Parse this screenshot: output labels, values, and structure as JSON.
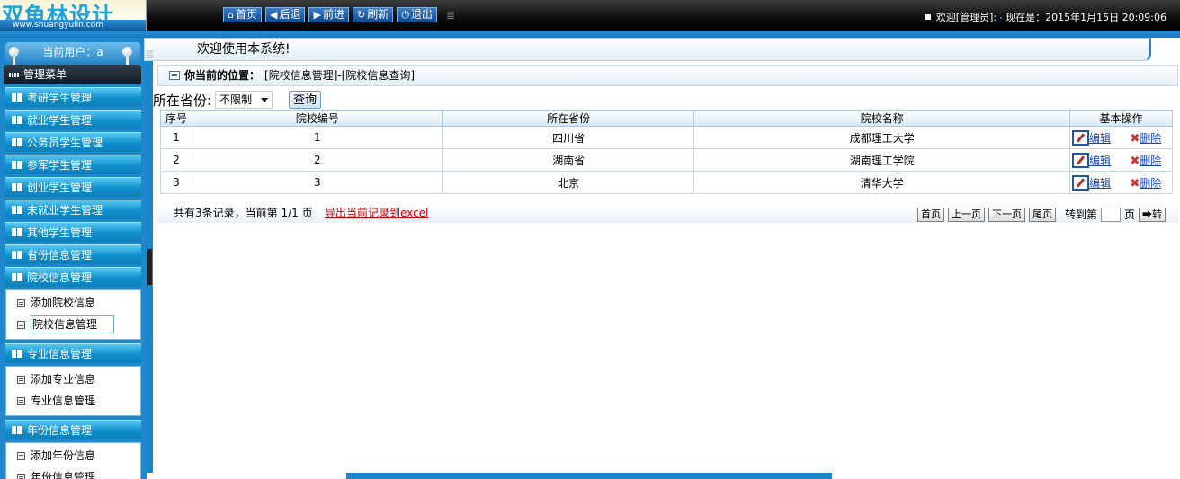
{
  "logo": {
    "main": "双鱼林设计",
    "sub": "www.shuangyulin.com"
  },
  "nav": [
    {
      "icon": "home-icon",
      "glyph": "⌂",
      "label": "首页"
    },
    {
      "icon": "back-icon",
      "glyph": "◀",
      "label": "后退"
    },
    {
      "icon": "forward-icon",
      "glyph": "▶",
      "label": "前进"
    },
    {
      "icon": "refresh-icon",
      "glyph": "↻",
      "label": "刷新"
    },
    {
      "icon": "power-icon",
      "glyph": "⏻",
      "label": "退出"
    }
  ],
  "header": {
    "welcome": "欢迎[管理员]:",
    "time": "现在是：2015年1月15日 20:09:06"
  },
  "sidebar": {
    "current_user": "当前用户：a",
    "menu_title": "管理菜单",
    "items": [
      {
        "label": "考研学生管理"
      },
      {
        "label": "就业学生管理"
      },
      {
        "label": "公务员学生管理"
      },
      {
        "label": "参军学生管理"
      },
      {
        "label": "创业学生管理"
      },
      {
        "label": "未就业学生管理"
      },
      {
        "label": "其他学生管理"
      },
      {
        "label": "省份信息管理"
      }
    ],
    "groups": [
      {
        "label": "院校信息管理",
        "subs": [
          "添加院校信息",
          "院校信息管理"
        ]
      },
      {
        "label": "专业信息管理",
        "subs": [
          "添加专业信息",
          "专业信息管理"
        ]
      },
      {
        "label": "年份信息管理",
        "subs": [
          "添加年份信息",
          "年份信息管理"
        ]
      }
    ]
  },
  "main": {
    "welcome": "欢迎使用本系统!",
    "crumb_label": "你当前的位置：",
    "crumb_path": "[院校信息管理]-[院校信息查询]",
    "filter_label": "所在省份:",
    "filter_value": "不限制",
    "query_button": "查询",
    "columns": [
      "序号",
      "院校编号",
      "所在省份",
      "院校名称",
      "基本操作"
    ],
    "rows": [
      {
        "no": "1",
        "code": "1",
        "province": "四川省",
        "name": "成都理工大学"
      },
      {
        "no": "2",
        "code": "2",
        "province": "湖南省",
        "name": "湖南理工学院"
      },
      {
        "no": "3",
        "code": "3",
        "province": "北京",
        "name": "清华大学"
      }
    ],
    "edit_label": "编辑",
    "delete_label": "删除",
    "pager": {
      "info": "共有3条记录，当前第 1/1 页",
      "export": "导出当前记录到excel",
      "first": "首页",
      "prev": "上一页",
      "next": "下一页",
      "last": "尾页",
      "goto_label": "转到第",
      "page_unit": "页",
      "go": "➡转"
    }
  }
}
